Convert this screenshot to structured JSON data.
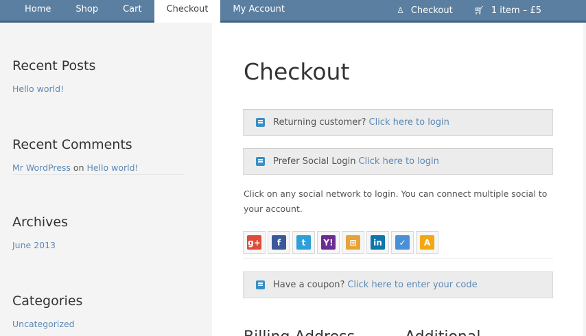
{
  "nav": {
    "items": [
      "Home",
      "Shop",
      "Cart",
      "Checkout",
      "My Account"
    ],
    "active_index": 3,
    "checkout_label": "Checkout",
    "cart_label": "1 item – £5"
  },
  "sidebar": {
    "recent_posts": {
      "title": "Recent Posts",
      "link": "Hello world!"
    },
    "recent_comments": {
      "title": "Recent Comments",
      "author": "Mr WordPress",
      "on": "on",
      "post": "Hello world!"
    },
    "archives": {
      "title": "Archives",
      "link": "June 2013"
    },
    "categories": {
      "title": "Categories",
      "link": "Uncategorized"
    }
  },
  "main": {
    "title": "Checkout",
    "returning": {
      "text": "Returning customer?",
      "link": "Click here to login"
    },
    "social_login": {
      "text": "Prefer Social Login",
      "link": "Click here to login"
    },
    "social_text": "Click on any social network to login. You can connect multiple social to your account.",
    "social_networks": [
      {
        "name": "google",
        "glyph": "g+",
        "color": "#dd4b39"
      },
      {
        "name": "facebook",
        "glyph": "f",
        "color": "#3b5998"
      },
      {
        "name": "twitter",
        "glyph": "t",
        "color": "#2f9fd8"
      },
      {
        "name": "yahoo",
        "glyph": "Y!",
        "color": "#6b2d91"
      },
      {
        "name": "windows-live",
        "glyph": "⊞",
        "color": "#e8a23b"
      },
      {
        "name": "linkedin",
        "glyph": "in",
        "color": "#0e76a8"
      },
      {
        "name": "foursquare",
        "glyph": "✓",
        "color": "#4a90d9"
      },
      {
        "name": "aim",
        "glyph": "A",
        "color": "#f2a813"
      }
    ],
    "coupon": {
      "text": "Have a coupon?",
      "link": "Click here to enter your code"
    },
    "billing_heading": "Billing Address",
    "additional_heading": "Additional"
  }
}
